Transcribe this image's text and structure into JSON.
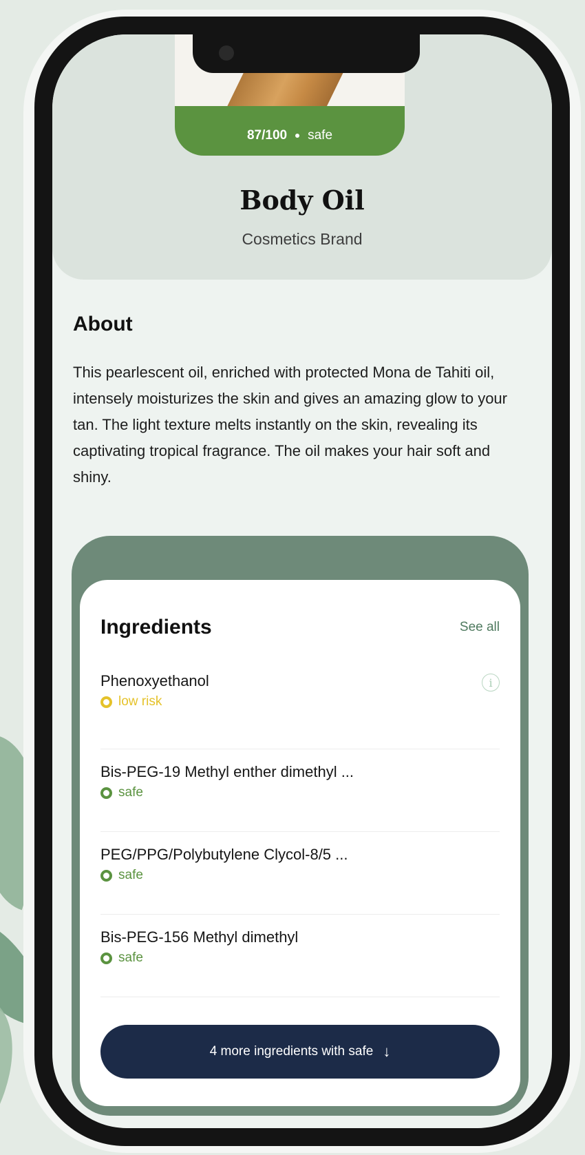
{
  "product": {
    "score": "87/100",
    "score_label": "safe",
    "name": "Body Oil",
    "brand": "Cosmetics Brand",
    "image": "body-oil-bottle-image"
  },
  "about": {
    "title": "About",
    "text": "This pearlescent oil, enriched with protected Mona de Tahiti oil, intensely moisturizes the skin and gives an amazing glow to your tan. The light texture melts instantly on the skin, revealing its captivating tropical fragrance. The oil makes your hair soft and shiny."
  },
  "ingredients": {
    "title": "Ingredients",
    "see_all": "See all",
    "items": [
      {
        "name": "Phenoxyethanol",
        "status": "low risk",
        "color": "#e5c22a",
        "info_icon": "info-icon"
      },
      {
        "name": "Bis-PEG-19 Methyl enther dimethyl ...",
        "status": "safe",
        "color": "#5b9340"
      },
      {
        "name": "PEG/PPG/Polybutylene Clycol-8/5 ...",
        "status": "safe",
        "color": "#5b9340"
      },
      {
        "name": "Bis-PEG-156 Methyl dimethyl",
        "status": "safe",
        "color": "#5b9340"
      }
    ],
    "more_button": "4 more ingredients with safe",
    "more_icon": "arrow-down-icon"
  },
  "colors": {
    "score_green": "#5b9340",
    "panel": "#6e8a79",
    "button": "#1c2b48",
    "background": "#e4ebe5"
  }
}
